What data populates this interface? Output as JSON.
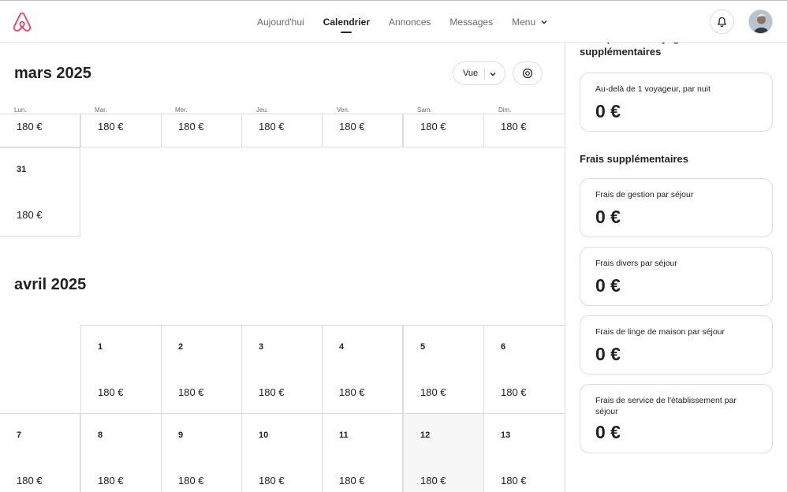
{
  "nav": {
    "items": [
      {
        "label": "Aujourd'hui",
        "active": false
      },
      {
        "label": "Calendrier",
        "active": true
      },
      {
        "label": "Annonces",
        "active": false
      },
      {
        "label": "Messages",
        "active": false
      },
      {
        "label": "Menu",
        "active": false
      }
    ]
  },
  "calendar": {
    "toolbar": {
      "view_label": "Vue"
    },
    "weekdays": [
      "Lun.",
      "Mar.",
      "Mer.",
      "Jeu.",
      "Ven.",
      "Sam.",
      "Dim."
    ],
    "months": [
      {
        "title": "mars 2025",
        "rows": [
          [
            {
              "day": "",
              "price": "180 €"
            },
            {
              "day": "",
              "price": "180 €"
            },
            {
              "day": "",
              "price": "180 €"
            },
            {
              "day": "",
              "price": "180 €"
            },
            {
              "day": "",
              "price": "180 €"
            },
            {
              "day": "",
              "price": "180 €"
            },
            {
              "day": "",
              "price": "180 €"
            }
          ],
          [
            {
              "day": "31",
              "price": "180 €"
            }
          ]
        ]
      },
      {
        "title": "avril 2025",
        "rows": [
          [
            {
              "day": "1",
              "price": "180 €"
            },
            {
              "day": "2",
              "price": "180 €"
            },
            {
              "day": "3",
              "price": "180 €"
            },
            {
              "day": "4",
              "price": "180 €"
            },
            {
              "day": "5",
              "price": "180 €"
            },
            {
              "day": "6",
              "price": "180 €"
            }
          ],
          [
            {
              "day": "7",
              "price": "180 €"
            },
            {
              "day": "8",
              "price": "180 €"
            },
            {
              "day": "9",
              "price": "180 €"
            },
            {
              "day": "10",
              "price": "180 €"
            },
            {
              "day": "11",
              "price": "180 €"
            },
            {
              "day": "12",
              "price": "180 €",
              "today": true
            },
            {
              "day": "13",
              "price": "180 €"
            }
          ]
        ]
      }
    ]
  },
  "panel": {
    "guest_fees_heading": "Frais pour les voyageurs supplémentaires",
    "guest_fee": {
      "label": "Au-delà de 1 voyageur, par nuit",
      "value": "0 €"
    },
    "extra_fees_heading": "Frais supplémentaires",
    "extra_fees": [
      {
        "label": "Frais de gestion par séjour",
        "value": "0 €"
      },
      {
        "label": "Frais divers par séjour",
        "value": "0 €"
      },
      {
        "label": "Frais de linge de maison par séjour",
        "value": "0 €"
      },
      {
        "label": "Frais de service de l'établissement par séjour",
        "value": "0 €"
      }
    ]
  },
  "colors": {
    "brand": "#ff385c",
    "border": "#dddddd",
    "today_bg": "#f7f7f7"
  },
  "icons": [
    "airbnb-logo-icon",
    "chevron-down-icon",
    "bell-icon",
    "settings-icon"
  ]
}
